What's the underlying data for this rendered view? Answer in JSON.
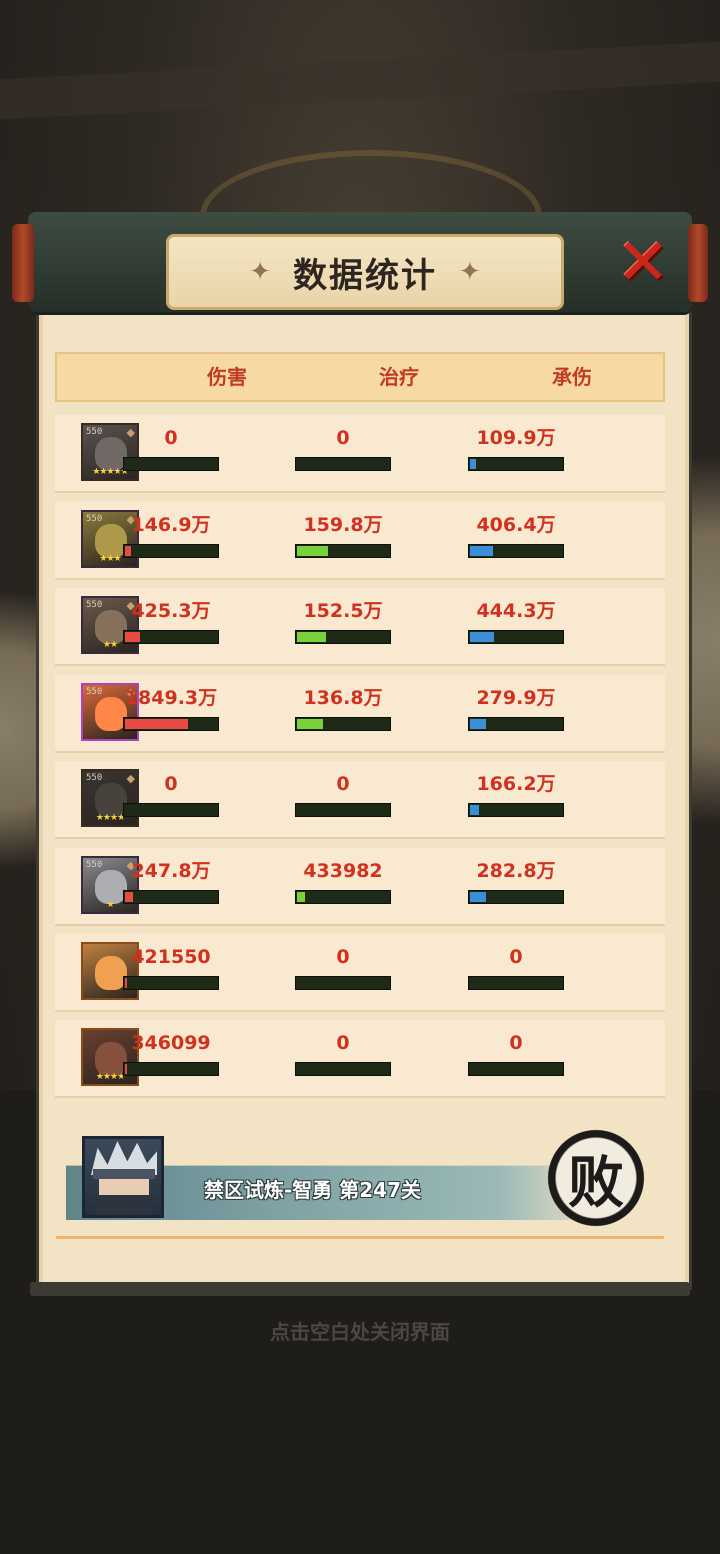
{
  "title": "数据统计",
  "columns": [
    "伤害",
    "治疗",
    "承伤"
  ],
  "rows": [
    {
      "level": "550",
      "stars": "★★★★★",
      "dmg": "0",
      "dmg_pct": 0,
      "heal": "0",
      "heal_pct": 0,
      "tank": "109.9万",
      "tank_pct": 6,
      "portrait": "#5a5350",
      "frame": "#3a2a20"
    },
    {
      "level": "550",
      "stars": "★★★",
      "dmg": "146.9万",
      "dmg_pct": 6,
      "heal": "159.8万",
      "heal_pct": 33,
      "tank": "406.4万",
      "tank_pct": 24,
      "portrait": "#8a7a3a",
      "frame": "#3a2a40"
    },
    {
      "level": "550",
      "stars": "★★",
      "dmg": "425.3万",
      "dmg_pct": 16,
      "heal": "152.5万",
      "heal_pct": 31,
      "tank": "444.3万",
      "tank_pct": 26,
      "portrait": "#6a5a4a",
      "frame": "#3a2a40"
    },
    {
      "level": "550",
      "stars": "",
      "dmg": "1849.3万",
      "dmg_pct": 67,
      "heal": "136.8万",
      "heal_pct": 28,
      "tank": "279.9万",
      "tank_pct": 17,
      "portrait": "#d86a3a",
      "frame": "#b040c0"
    },
    {
      "level": "550",
      "stars": "★★★★",
      "dmg": "0",
      "dmg_pct": 0,
      "heal": "0",
      "heal_pct": 0,
      "tank": "166.2万",
      "tank_pct": 10,
      "portrait": "#3a3530",
      "frame": "#3a2a20"
    },
    {
      "level": "550",
      "stars": "★",
      "dmg": "247.8万",
      "dmg_pct": 9,
      "heal": "433982",
      "heal_pct": 9,
      "tank": "282.8万",
      "tank_pct": 17,
      "portrait": "#8a8a90",
      "frame": "#3a2a40"
    },
    {
      "level": "",
      "stars": "",
      "dmg": "421550",
      "dmg_pct": 2,
      "heal": "0",
      "heal_pct": 0,
      "tank": "0",
      "tank_pct": 0,
      "portrait": "#c08040",
      "frame": "#8a4a1a"
    },
    {
      "level": "",
      "stars": "★★★★",
      "dmg": "346099",
      "dmg_pct": 1,
      "heal": "0",
      "heal_pct": 0,
      "tank": "0",
      "tank_pct": 0,
      "portrait": "#6a4030",
      "frame": "#8a4a1a"
    }
  ],
  "bar_colors": {
    "damage": "#e84a44",
    "heal": "#79d23a",
    "tank": "#3a8fd8"
  },
  "stage": "禁区试炼-智勇 第247关",
  "result": "败",
  "close_hint": "点击空白处关闭界面"
}
